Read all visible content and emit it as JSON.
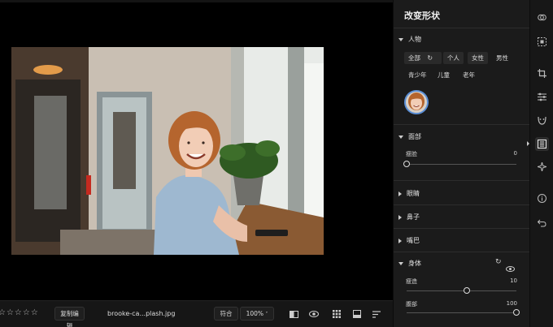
{
  "panel": {
    "title": "改变形状",
    "sections": {
      "person": {
        "title": "人物",
        "filters": [
          "全部",
          "个人",
          "女性",
          "男性",
          "青少年",
          "儿童",
          "老年"
        ]
      },
      "face": {
        "title": "面部",
        "slider_label": "瘦脸",
        "slider_value": "0",
        "slider_level": 0
      },
      "eyes": {
        "title": "眼睛"
      },
      "nose": {
        "title": "鼻子"
      },
      "mouth": {
        "title": "嘴巴"
      },
      "body": {
        "title": "身体",
        "sliders": [
          {
            "label": "瘦造",
            "value": "10",
            "level": 0.55
          },
          {
            "label": "腹部",
            "value": "100",
            "level": 1.0
          }
        ]
      }
    }
  },
  "bottombar": {
    "rating_stars": "☆☆☆☆☆",
    "copy_edit_label": "复制编辑",
    "filename": "brooke-ca...plash.jpg",
    "fit_label": "符合",
    "zoom_label": "100%"
  },
  "colors": {
    "panel_bg": "#1b1b1b",
    "accent_text": "#f0f0f0",
    "canvas_bg": "#000000"
  }
}
